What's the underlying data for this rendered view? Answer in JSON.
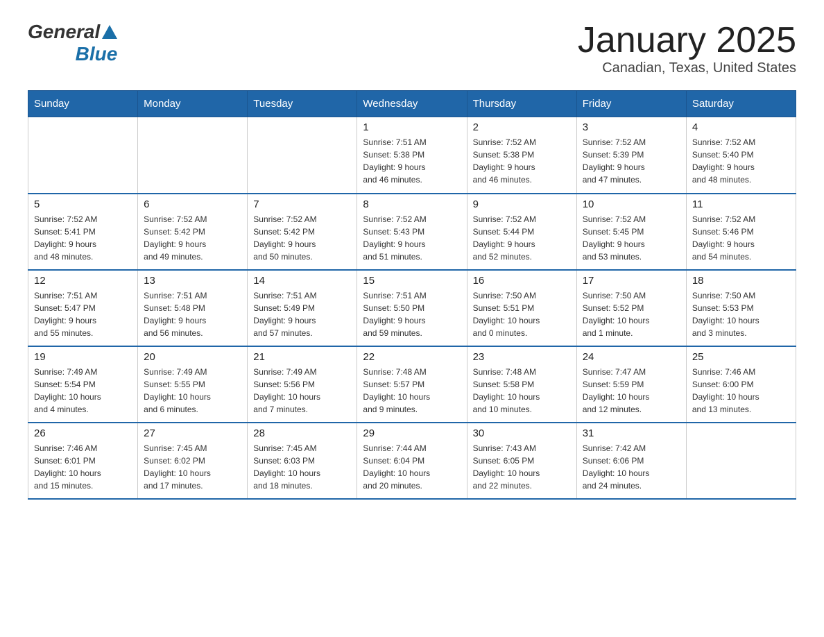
{
  "logo": {
    "general": "General",
    "blue": "Blue"
  },
  "title": "January 2025",
  "subtitle": "Canadian, Texas, United States",
  "days_of_week": [
    "Sunday",
    "Monday",
    "Tuesday",
    "Wednesday",
    "Thursday",
    "Friday",
    "Saturday"
  ],
  "weeks": [
    [
      {
        "day": "",
        "info": ""
      },
      {
        "day": "",
        "info": ""
      },
      {
        "day": "",
        "info": ""
      },
      {
        "day": "1",
        "info": "Sunrise: 7:51 AM\nSunset: 5:38 PM\nDaylight: 9 hours\nand 46 minutes."
      },
      {
        "day": "2",
        "info": "Sunrise: 7:52 AM\nSunset: 5:38 PM\nDaylight: 9 hours\nand 46 minutes."
      },
      {
        "day": "3",
        "info": "Sunrise: 7:52 AM\nSunset: 5:39 PM\nDaylight: 9 hours\nand 47 minutes."
      },
      {
        "day": "4",
        "info": "Sunrise: 7:52 AM\nSunset: 5:40 PM\nDaylight: 9 hours\nand 48 minutes."
      }
    ],
    [
      {
        "day": "5",
        "info": "Sunrise: 7:52 AM\nSunset: 5:41 PM\nDaylight: 9 hours\nand 48 minutes."
      },
      {
        "day": "6",
        "info": "Sunrise: 7:52 AM\nSunset: 5:42 PM\nDaylight: 9 hours\nand 49 minutes."
      },
      {
        "day": "7",
        "info": "Sunrise: 7:52 AM\nSunset: 5:42 PM\nDaylight: 9 hours\nand 50 minutes."
      },
      {
        "day": "8",
        "info": "Sunrise: 7:52 AM\nSunset: 5:43 PM\nDaylight: 9 hours\nand 51 minutes."
      },
      {
        "day": "9",
        "info": "Sunrise: 7:52 AM\nSunset: 5:44 PM\nDaylight: 9 hours\nand 52 minutes."
      },
      {
        "day": "10",
        "info": "Sunrise: 7:52 AM\nSunset: 5:45 PM\nDaylight: 9 hours\nand 53 minutes."
      },
      {
        "day": "11",
        "info": "Sunrise: 7:52 AM\nSunset: 5:46 PM\nDaylight: 9 hours\nand 54 minutes."
      }
    ],
    [
      {
        "day": "12",
        "info": "Sunrise: 7:51 AM\nSunset: 5:47 PM\nDaylight: 9 hours\nand 55 minutes."
      },
      {
        "day": "13",
        "info": "Sunrise: 7:51 AM\nSunset: 5:48 PM\nDaylight: 9 hours\nand 56 minutes."
      },
      {
        "day": "14",
        "info": "Sunrise: 7:51 AM\nSunset: 5:49 PM\nDaylight: 9 hours\nand 57 minutes."
      },
      {
        "day": "15",
        "info": "Sunrise: 7:51 AM\nSunset: 5:50 PM\nDaylight: 9 hours\nand 59 minutes."
      },
      {
        "day": "16",
        "info": "Sunrise: 7:50 AM\nSunset: 5:51 PM\nDaylight: 10 hours\nand 0 minutes."
      },
      {
        "day": "17",
        "info": "Sunrise: 7:50 AM\nSunset: 5:52 PM\nDaylight: 10 hours\nand 1 minute."
      },
      {
        "day": "18",
        "info": "Sunrise: 7:50 AM\nSunset: 5:53 PM\nDaylight: 10 hours\nand 3 minutes."
      }
    ],
    [
      {
        "day": "19",
        "info": "Sunrise: 7:49 AM\nSunset: 5:54 PM\nDaylight: 10 hours\nand 4 minutes."
      },
      {
        "day": "20",
        "info": "Sunrise: 7:49 AM\nSunset: 5:55 PM\nDaylight: 10 hours\nand 6 minutes."
      },
      {
        "day": "21",
        "info": "Sunrise: 7:49 AM\nSunset: 5:56 PM\nDaylight: 10 hours\nand 7 minutes."
      },
      {
        "day": "22",
        "info": "Sunrise: 7:48 AM\nSunset: 5:57 PM\nDaylight: 10 hours\nand 9 minutes."
      },
      {
        "day": "23",
        "info": "Sunrise: 7:48 AM\nSunset: 5:58 PM\nDaylight: 10 hours\nand 10 minutes."
      },
      {
        "day": "24",
        "info": "Sunrise: 7:47 AM\nSunset: 5:59 PM\nDaylight: 10 hours\nand 12 minutes."
      },
      {
        "day": "25",
        "info": "Sunrise: 7:46 AM\nSunset: 6:00 PM\nDaylight: 10 hours\nand 13 minutes."
      }
    ],
    [
      {
        "day": "26",
        "info": "Sunrise: 7:46 AM\nSunset: 6:01 PM\nDaylight: 10 hours\nand 15 minutes."
      },
      {
        "day": "27",
        "info": "Sunrise: 7:45 AM\nSunset: 6:02 PM\nDaylight: 10 hours\nand 17 minutes."
      },
      {
        "day": "28",
        "info": "Sunrise: 7:45 AM\nSunset: 6:03 PM\nDaylight: 10 hours\nand 18 minutes."
      },
      {
        "day": "29",
        "info": "Sunrise: 7:44 AM\nSunset: 6:04 PM\nDaylight: 10 hours\nand 20 minutes."
      },
      {
        "day": "30",
        "info": "Sunrise: 7:43 AM\nSunset: 6:05 PM\nDaylight: 10 hours\nand 22 minutes."
      },
      {
        "day": "31",
        "info": "Sunrise: 7:42 AM\nSunset: 6:06 PM\nDaylight: 10 hours\nand 24 minutes."
      },
      {
        "day": "",
        "info": ""
      }
    ]
  ]
}
